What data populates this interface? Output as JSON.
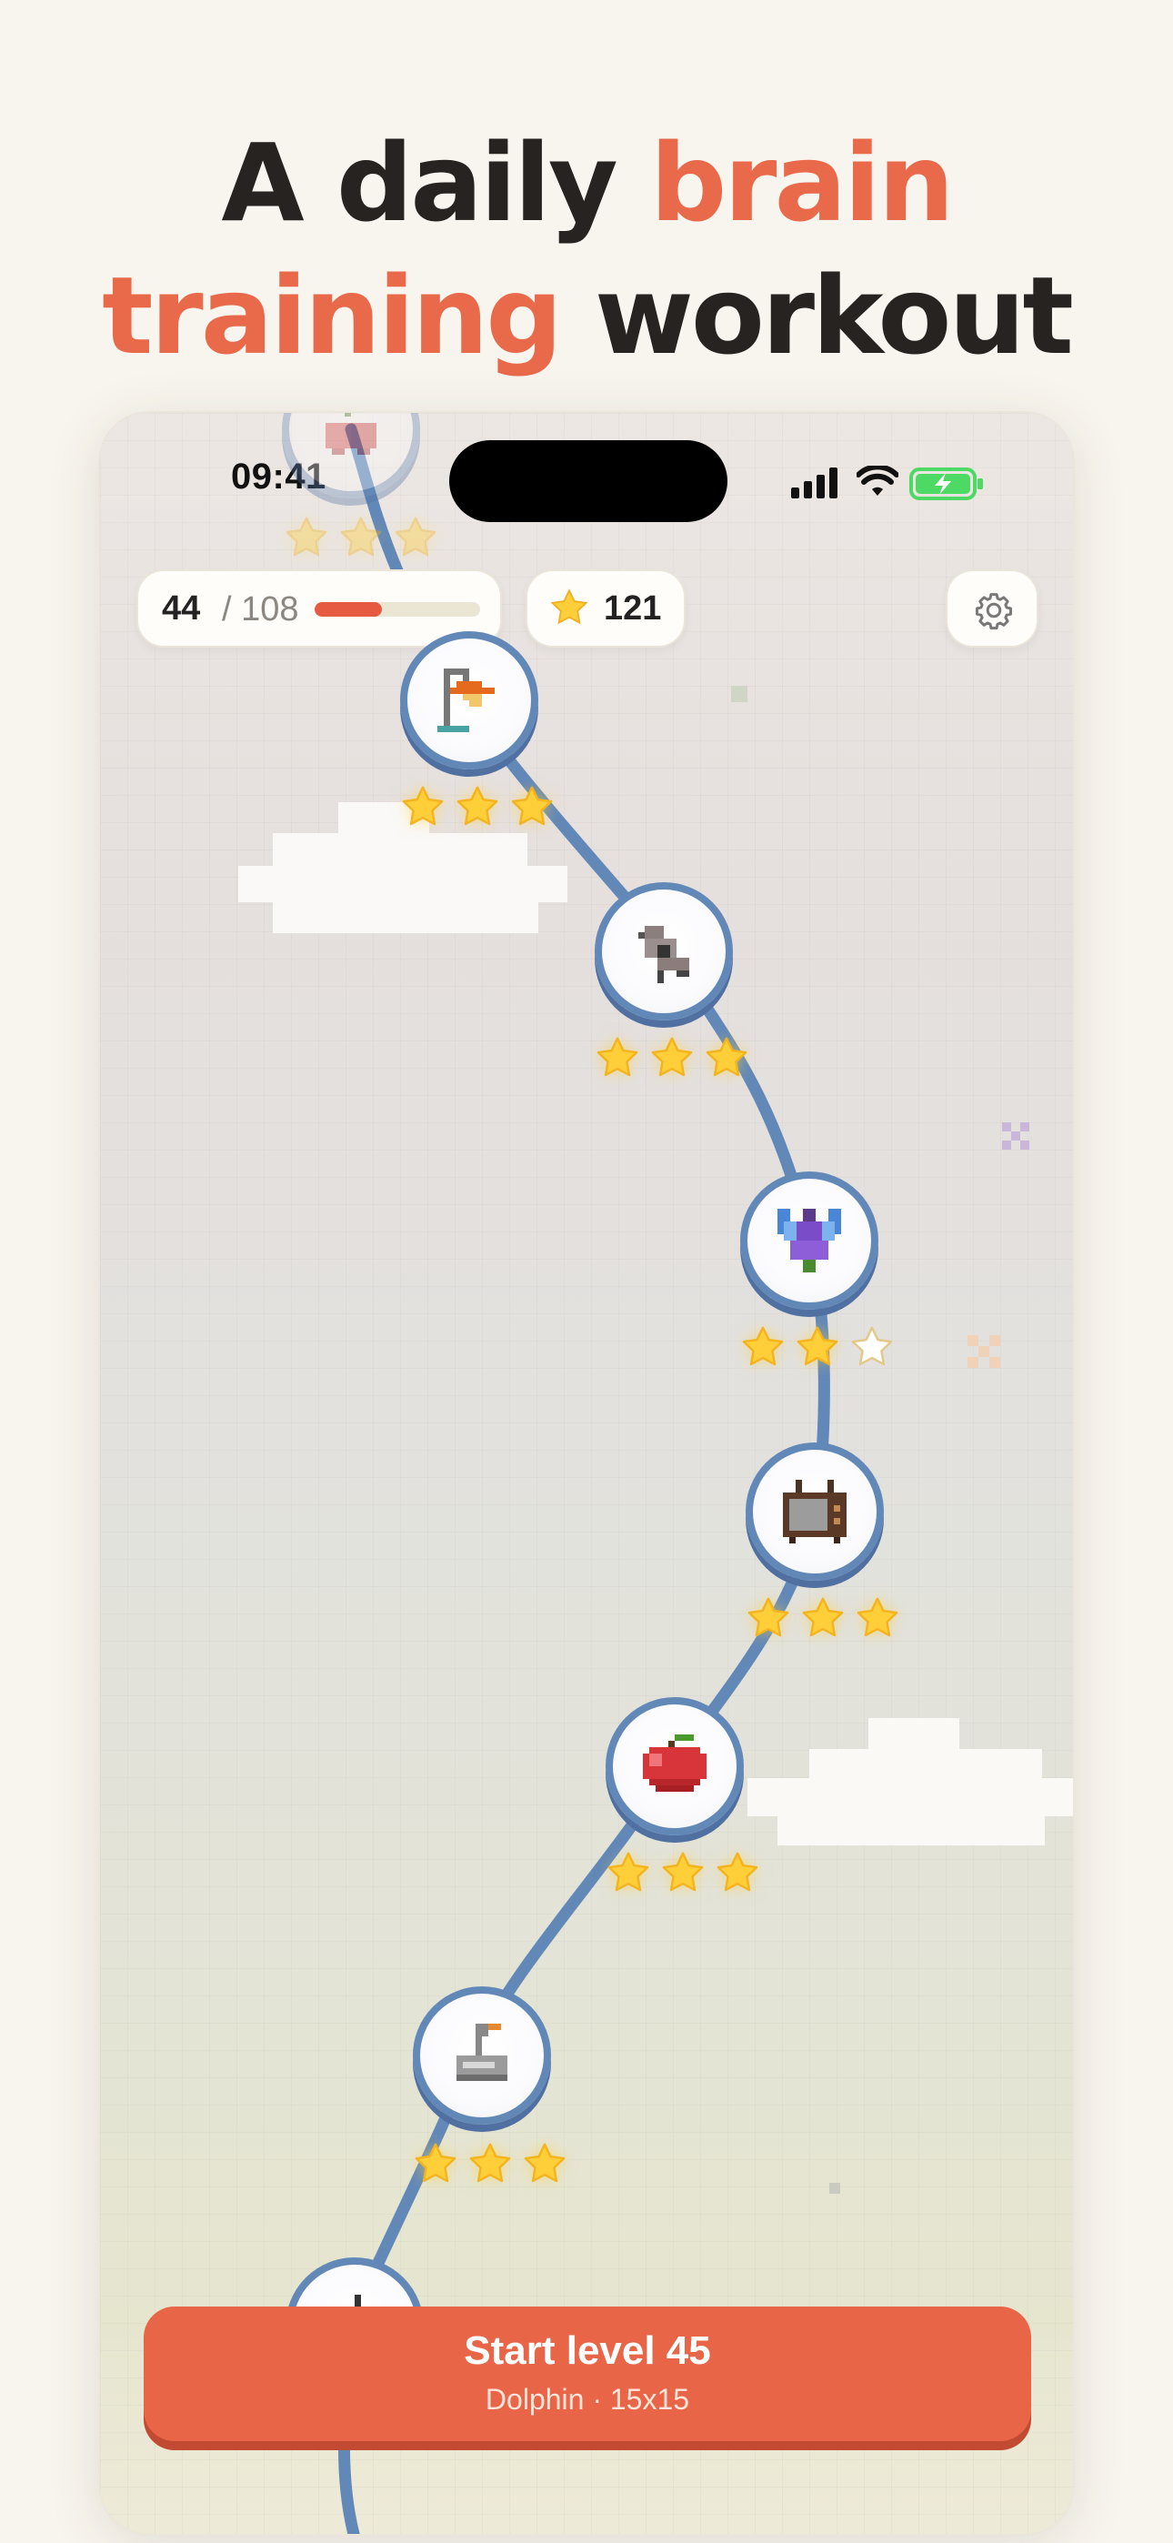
{
  "headline": {
    "line1_plain": "A daily ",
    "line1_accent": "brain",
    "line2_accent": "training",
    "line2_plain": " workout"
  },
  "status_bar": {
    "time": "09:41"
  },
  "header": {
    "progress_current": "44",
    "progress_total": "/ 108",
    "progress_fraction": 0.407,
    "stars_total": "121"
  },
  "levels": [
    {
      "icon": "cherry-icon",
      "stars": 3
    },
    {
      "icon": "lamp-icon",
      "stars": 3
    },
    {
      "icon": "bird-icon",
      "stars": 3
    },
    {
      "icon": "fairy-icon",
      "stars": 2
    },
    {
      "icon": "tv-icon",
      "stars": 3
    },
    {
      "icon": "apple-icon",
      "stars": 3
    },
    {
      "icon": "goose-icon",
      "stars": 3
    }
  ],
  "cta": {
    "title": "Start level 45",
    "subtitle": "Dolphin · 15x15"
  },
  "colors": {
    "accent": "#e86a4b",
    "path": "#6288b8",
    "star": "#ffcf3a",
    "battery": "#4cd964"
  }
}
